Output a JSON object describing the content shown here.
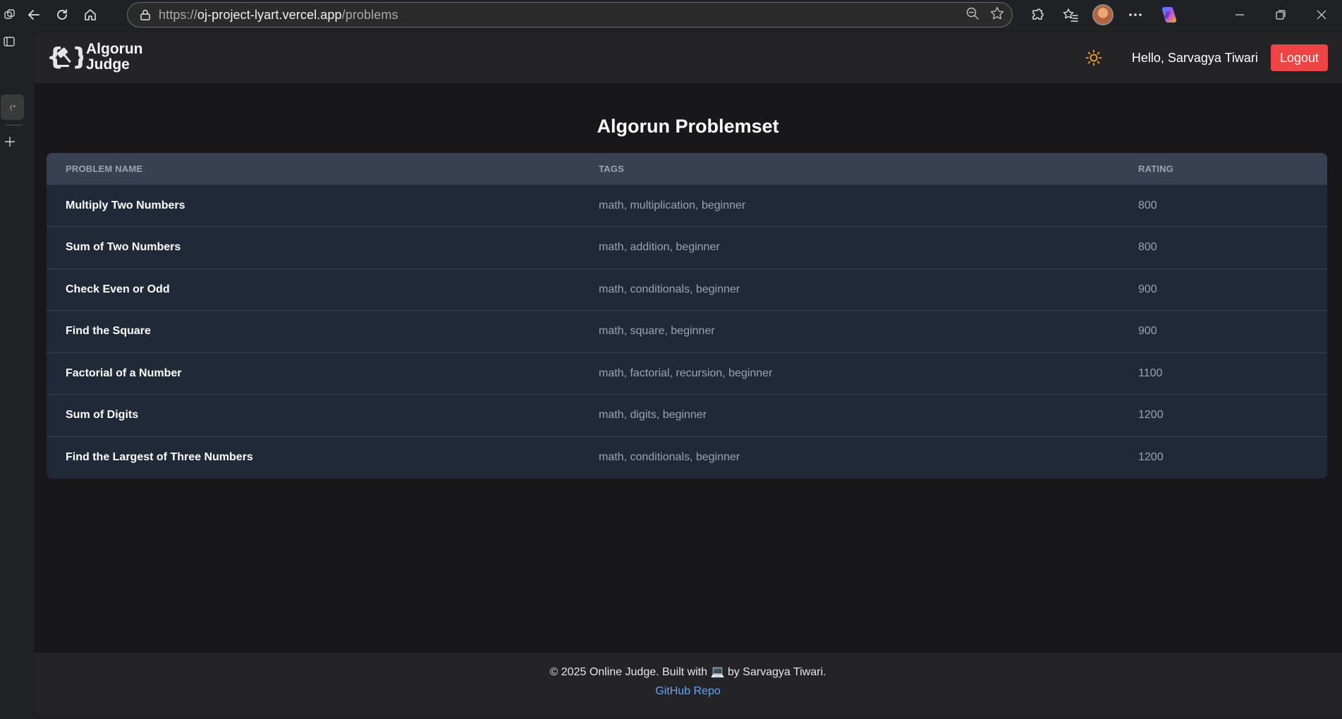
{
  "browser": {
    "url_scheme": "https://",
    "url_host": "oj-project-lyart.vercel.app",
    "url_path": "/problems"
  },
  "navbar": {
    "logo_line1": "Algorun",
    "logo_line2": "Judge",
    "greeting": "Hello, Sarvagya Tiwari",
    "logout_label": "Logout"
  },
  "main": {
    "title": "Algorun Problemset",
    "columns": [
      "PROBLEM NAME",
      "TAGS",
      "RATING"
    ],
    "problems": [
      {
        "name": "Multiply Two Numbers",
        "tags": "math, multiplication, beginner",
        "rating": "800"
      },
      {
        "name": "Sum of Two Numbers",
        "tags": "math, addition, beginner",
        "rating": "800"
      },
      {
        "name": "Check Even or Odd",
        "tags": "math, conditionals, beginner",
        "rating": "900"
      },
      {
        "name": "Find the Square",
        "tags": "math, square, beginner",
        "rating": "900"
      },
      {
        "name": "Factorial of a Number",
        "tags": "math, factorial, recursion, beginner",
        "rating": "1100"
      },
      {
        "name": "Sum of Digits",
        "tags": "math, digits, beginner",
        "rating": "1200"
      },
      {
        "name": "Find the Largest of Three Numbers",
        "tags": "math, conditionals, beginner",
        "rating": "1200"
      }
    ]
  },
  "footer": {
    "copyright": "© 2025 Online Judge. Built with 💻 by Sarvagya Tiwari.",
    "repo_link": "GitHub Repo"
  },
  "colors": {
    "logout_bg": "#ef4444",
    "link": "#60a5fa",
    "theme_icon": "#f5a623"
  },
  "icons": [
    "workspaces-icon",
    "back-icon",
    "refresh-icon",
    "home-icon",
    "site-info-icon",
    "zoom-out-icon",
    "favorite-star-icon",
    "extensions-icon",
    "favorites-icon",
    "profile-avatar",
    "more-icon",
    "copilot-icon",
    "minimize-icon",
    "restore-icon",
    "close-icon",
    "tab-sidebar-icon",
    "new-tab-icon",
    "sun-icon"
  ]
}
